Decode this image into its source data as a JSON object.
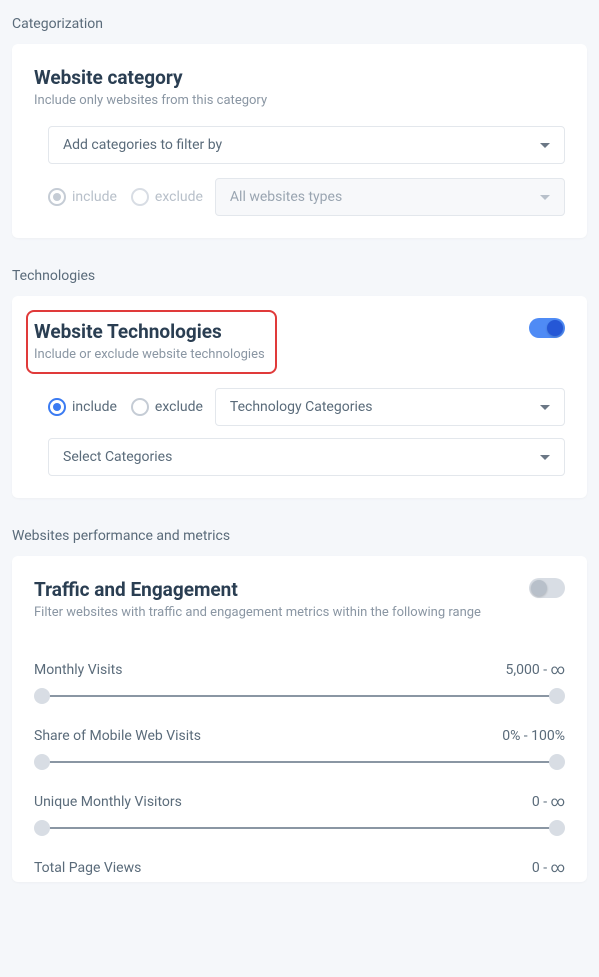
{
  "sections": {
    "categorization": {
      "label": "Categorization"
    },
    "technologies": {
      "label": "Technologies"
    },
    "performance": {
      "label": "Websites performance and metrics"
    }
  },
  "websiteCategory": {
    "title": "Website category",
    "subtitle": "Include only websites from this category",
    "addCategoriesPlaceholder": "Add categories to filter by",
    "includeLabel": "include",
    "excludeLabel": "exclude",
    "typeDropdown": "All websites types"
  },
  "websiteTechnologies": {
    "title": "Website Technologies",
    "subtitle": "Include or exclude website technologies",
    "includeLabel": "include",
    "excludeLabel": "exclude",
    "techCategoriesDropdown": "Technology Categories",
    "selectCategoriesDropdown": "Select Categories"
  },
  "trafficEngagement": {
    "title": "Traffic and Engagement",
    "subtitle": "Filter websites with traffic and engagement metrics within the following range",
    "metrics": [
      {
        "label": "Monthly Visits",
        "value": "5,000 - ∞"
      },
      {
        "label": "Share of Mobile Web Visits",
        "value": "0% - 100%"
      },
      {
        "label": "Unique Monthly Visitors",
        "value": "0 - ∞"
      },
      {
        "label": "Total Page Views",
        "value": "0 - ∞"
      }
    ]
  }
}
